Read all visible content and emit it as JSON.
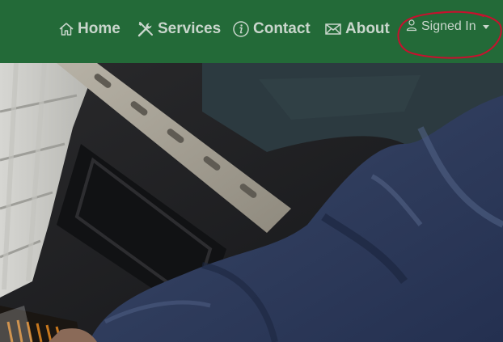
{
  "nav": {
    "items": [
      {
        "label": "Home",
        "icon": "home-icon"
      },
      {
        "label": "Services",
        "icon": "tools-icon"
      },
      {
        "label": "Contact",
        "icon": "info-icon"
      },
      {
        "label": "About",
        "icon": "envelope-icon"
      }
    ],
    "account": {
      "label": "Signed In",
      "icon": "user-icon"
    }
  },
  "hero": {
    "image": "photo of a technician's arm in a blue work shirt next to an open computer case"
  },
  "colors": {
    "navbar": "#236a38",
    "nav_text": "#c9d6cc",
    "annotation": "#c8102e"
  }
}
